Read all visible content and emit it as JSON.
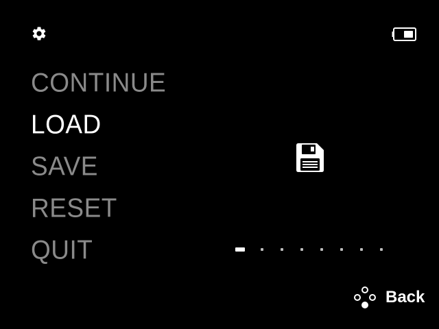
{
  "header": {
    "settings_icon": "gear-icon",
    "battery_icon": "battery-icon"
  },
  "menu": {
    "items": [
      {
        "label": "CONTINUE",
        "selected": false
      },
      {
        "label": "LOAD",
        "selected": true
      },
      {
        "label": "SAVE",
        "selected": false
      },
      {
        "label": "RESET",
        "selected": false
      },
      {
        "label": "QUIT",
        "selected": false
      }
    ]
  },
  "preview": {
    "icon": "save-icon",
    "pager": {
      "total": 8,
      "current": 1
    }
  },
  "footer": {
    "back_icon": "gamepad-buttons-icon",
    "back_label": "Back"
  },
  "colors": {
    "background": "#000000",
    "text_selected": "#ffffff",
    "text_inactive": "#8a8a8a"
  }
}
